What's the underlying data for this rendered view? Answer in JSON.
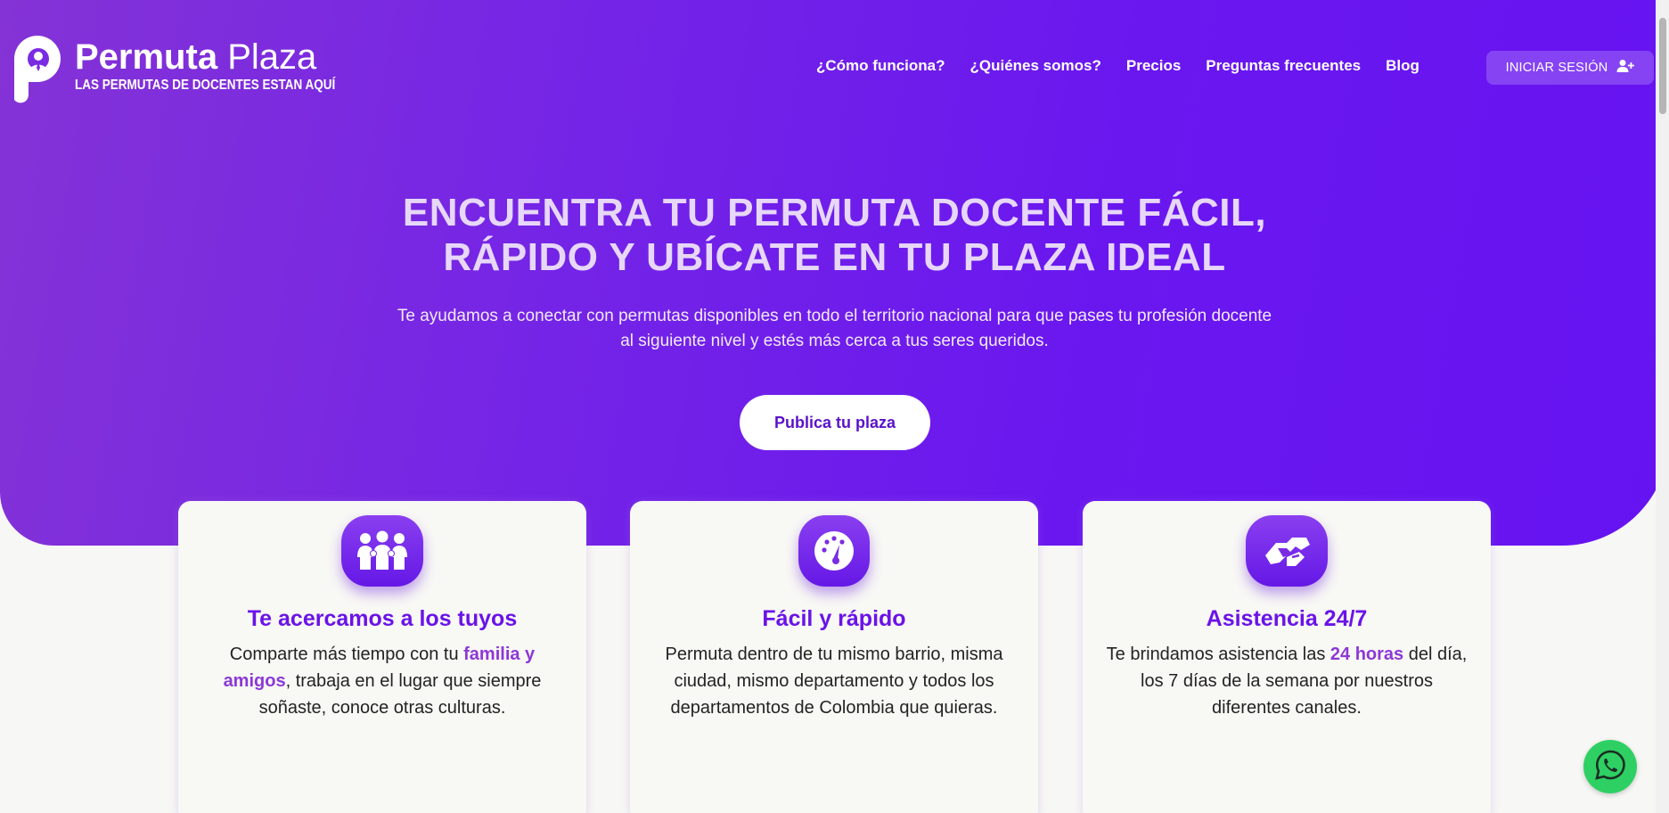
{
  "header": {
    "logo_bold": "Permuta",
    "logo_light": "Plaza",
    "tagline": "LAS PERMUTAS DE DOCENTES ESTAN AQUÍ",
    "nav": [
      {
        "label": "¿Cómo funciona?"
      },
      {
        "label": "¿Quiénes somos?"
      },
      {
        "label": "Precios"
      },
      {
        "label": "Preguntas frecuentes"
      },
      {
        "label": "Blog"
      }
    ],
    "login_label": "INICIAR SESIÓN"
  },
  "hero": {
    "title_line1": "ENCUENTRA TU PERMUTA DOCENTE FÁCIL,",
    "title_line2": "RÁPIDO Y UBÍCATE EN TU PLAZA IDEAL",
    "subtitle_line1": "Te ayudamos a conectar con permutas disponibles en todo el territorio nacional para que pases tu profesión docente",
    "subtitle_line2": "al siguiente nivel y estés más cerca a tus seres queridos.",
    "cta_label": "Publica tu plaza"
  },
  "cards": [
    {
      "icon": "family-icon",
      "title": "Te acercamos a los tuyos",
      "text_before": "Comparte más tiempo con tu ",
      "highlight": "familia y amigos",
      "text_after": ", trabaja en el lugar que siempre soñaste, conoce otras culturas."
    },
    {
      "icon": "speedometer-icon",
      "title": "Fácil y rápido",
      "text": "Permuta dentro de tu mismo barrio, misma ciudad, mismo departamento y todos los departamentos de Colombia que quieras."
    },
    {
      "icon": "handshake-icon",
      "title": "Asistencia 24/7",
      "text_before": "Te brindamos asistencia las ",
      "highlight": "24 horas",
      "text_after": " del día, los 7 días de la semana por nuestros diferentes canales."
    }
  ],
  "colors": {
    "hero_start": "#8433d6",
    "hero_end": "#6613f2",
    "accent": "#6a13e8",
    "highlight": "#8d38d6",
    "whatsapp": "#2fd063"
  }
}
